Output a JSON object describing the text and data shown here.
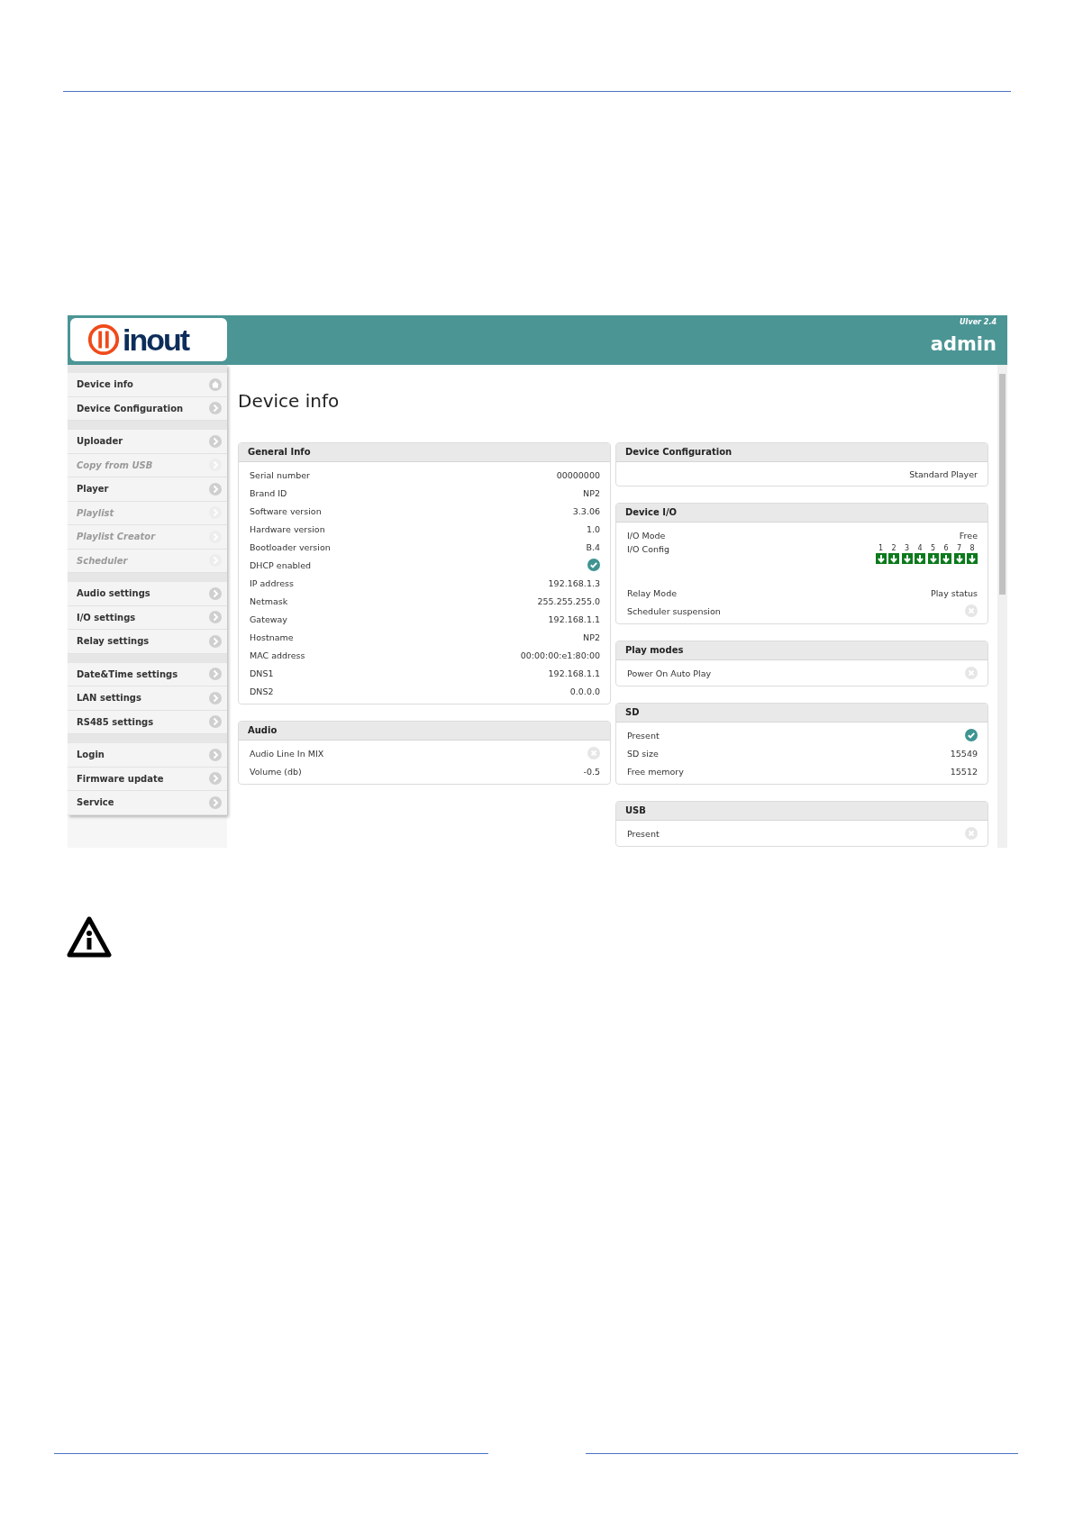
{
  "header": {
    "logo_text": "inout",
    "version": "UIver 2.4",
    "user": "admin"
  },
  "sidebar": {
    "groups": [
      {
        "items": [
          {
            "label": "Device info",
            "kind": "home",
            "disabled": false
          },
          {
            "label": "Device Configuration",
            "kind": "arrow",
            "disabled": false
          }
        ]
      },
      {
        "items": [
          {
            "label": "Uploader",
            "kind": "arrow",
            "disabled": false
          },
          {
            "label": "Copy from USB",
            "kind": "arrow",
            "disabled": true
          },
          {
            "label": "Player",
            "kind": "arrow",
            "disabled": false
          },
          {
            "label": "Playlist",
            "kind": "arrow",
            "disabled": true
          },
          {
            "label": "Playlist Creator",
            "kind": "arrow",
            "disabled": true
          },
          {
            "label": "Scheduler",
            "kind": "arrow",
            "disabled": true
          }
        ]
      },
      {
        "items": [
          {
            "label": "Audio settings",
            "kind": "arrow",
            "disabled": false
          },
          {
            "label": "I/O settings",
            "kind": "arrow",
            "disabled": false
          },
          {
            "label": "Relay settings",
            "kind": "arrow",
            "disabled": false
          }
        ]
      },
      {
        "items": [
          {
            "label": "Date&Time settings",
            "kind": "arrow",
            "disabled": false
          },
          {
            "label": "LAN settings",
            "kind": "arrow",
            "disabled": false
          },
          {
            "label": "RS485 settings",
            "kind": "arrow",
            "disabled": false
          }
        ]
      },
      {
        "items": [
          {
            "label": "Login",
            "kind": "arrow",
            "disabled": false
          },
          {
            "label": "Firmware update",
            "kind": "arrow",
            "disabled": false
          },
          {
            "label": "Service",
            "kind": "arrow",
            "disabled": false
          }
        ]
      }
    ]
  },
  "page_title": "Device info",
  "columns": [
    [
      {
        "title": "General Info",
        "rows": [
          {
            "kind": "text",
            "label": "Serial number",
            "value": "00000000"
          },
          {
            "kind": "text",
            "label": "Brand ID",
            "value": "NP2"
          },
          {
            "kind": "text",
            "label": "Software version",
            "value": "3.3.06"
          },
          {
            "kind": "text",
            "label": "Hardware version",
            "value": "1.0"
          },
          {
            "kind": "text",
            "label": "Bootloader version",
            "value": "B.4"
          },
          {
            "kind": "check",
            "label": "DHCP enabled",
            "on": true
          },
          {
            "kind": "text",
            "label": "IP address",
            "value": "192.168.1.3"
          },
          {
            "kind": "text",
            "label": "Netmask",
            "value": "255.255.255.0"
          },
          {
            "kind": "text",
            "label": "Gateway",
            "value": "192.168.1.1"
          },
          {
            "kind": "text",
            "label": "Hostname",
            "value": "NP2"
          },
          {
            "kind": "text",
            "label": "MAC address",
            "value": "00:00:00:e1:80:00"
          },
          {
            "kind": "text",
            "label": "DNS1",
            "value": "192.168.1.1"
          },
          {
            "kind": "text",
            "label": "DNS2",
            "value": "0.0.0.0"
          }
        ]
      },
      {
        "title": "Audio",
        "rows": [
          {
            "kind": "check",
            "label": "Audio Line In MIX",
            "on": false
          },
          {
            "kind": "text",
            "label": "Volume (db)",
            "value": "-0.5"
          }
        ]
      }
    ],
    [
      {
        "title": "Device Configuration",
        "rows": [
          {
            "kind": "value",
            "value": "Standard Player"
          }
        ]
      },
      {
        "title": "Device I/O",
        "rows": [
          {
            "kind": "text",
            "label": "I/O Mode",
            "value": "Free"
          },
          {
            "kind": "io",
            "label": "I/O Config",
            "ports": [
              {
                "label": "1",
                "kind": "input"
              },
              {
                "label": "2",
                "kind": "input"
              },
              {
                "label": "3",
                "kind": "input"
              },
              {
                "label": "4",
                "kind": "input"
              },
              {
                "label": "5",
                "kind": "input"
              },
              {
                "label": "6",
                "kind": "input"
              },
              {
                "label": "7",
                "kind": "input"
              },
              {
                "label": "8",
                "kind": "input"
              }
            ]
          },
          {
            "kind": "text",
            "label": "Relay Mode",
            "value": "Play status"
          },
          {
            "kind": "check",
            "label": "Scheduler suspension",
            "on": false
          }
        ]
      },
      {
        "title": "Play modes",
        "rows": [
          {
            "kind": "check",
            "label": "Power On Auto Play",
            "on": false
          }
        ]
      },
      {
        "title": "SD",
        "rows": [
          {
            "kind": "check",
            "label": "Present",
            "on": true
          },
          {
            "kind": "text",
            "label": "SD size",
            "value": "15549"
          },
          {
            "kind": "text",
            "label": "Free memory",
            "value": "15512"
          }
        ]
      },
      {
        "title": "USB",
        "rows": [
          {
            "kind": "check",
            "label": "Present",
            "on": false
          }
        ]
      }
    ]
  ]
}
